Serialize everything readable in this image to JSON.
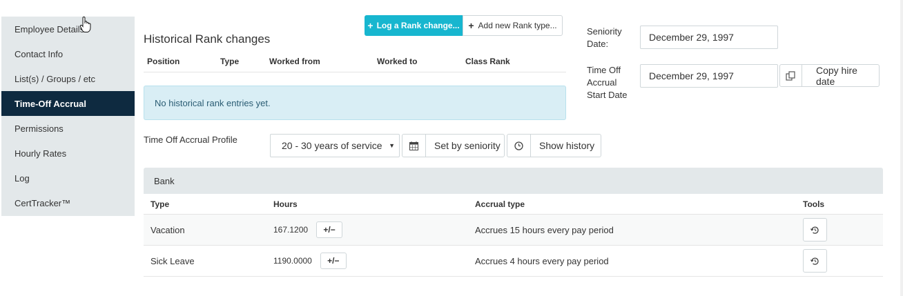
{
  "sidebar": {
    "items": [
      {
        "label": "Employee Details",
        "active": false
      },
      {
        "label": "Contact Info",
        "active": false
      },
      {
        "label": "List(s) / Groups / etc",
        "active": false
      },
      {
        "label": "Time-Off Accrual",
        "active": true
      },
      {
        "label": "Permissions",
        "active": false
      },
      {
        "label": "Hourly Rates",
        "active": false
      },
      {
        "label": "Log",
        "active": false
      },
      {
        "label": "CertTracker™",
        "active": false
      }
    ]
  },
  "rank": {
    "title": "Historical Rank changes",
    "log_button": "Log a Rank change...",
    "add_button": "Add new Rank type...",
    "columns": [
      "Position",
      "Type",
      "Worked from",
      "Worked to",
      "Class Rank"
    ],
    "empty_message": "No historical rank entries yet."
  },
  "dates": {
    "seniority_label": "Seniority Date:",
    "seniority_value": "December 29, 1997",
    "accrual_label": "Time Off Accrual Start Date",
    "accrual_value": "December 29, 1997",
    "copy_button": "Copy hire date"
  },
  "profile": {
    "label": "Time Off Accrual Profile",
    "selected": "20 - 30 years of service",
    "set_button": "Set by seniority",
    "history_button": "Show history"
  },
  "bank": {
    "title": "Bank",
    "columns": [
      "Type",
      "Hours",
      "Accrual type",
      "Tools"
    ],
    "rows": [
      {
        "type": "Vacation",
        "hours": "167.1200",
        "accrual": "Accrues 15 hours every pay period"
      },
      {
        "type": "Sick Leave",
        "hours": "1190.0000",
        "accrual": "Accrues 4 hours every pay period"
      }
    ],
    "adjust_label": "+/−"
  },
  "colors": {
    "accent": "#17b6cf",
    "sidebar_active": "#0e2a40",
    "sidebar_bg": "#e3e8ea",
    "info_bg": "#d9eef5"
  }
}
